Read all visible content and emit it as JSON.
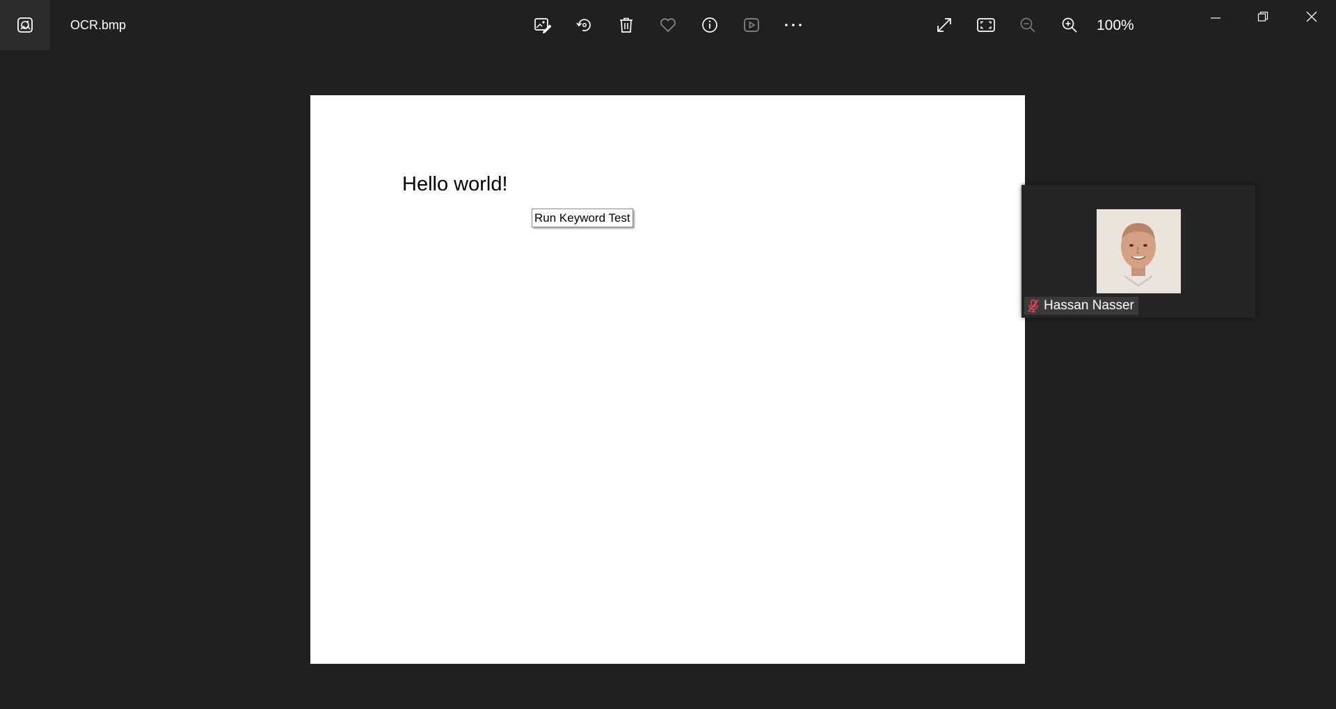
{
  "window": {
    "file_name": "OCR.bmp",
    "zoom_level": "100%"
  },
  "toolbar": {
    "icons": [
      "edit-image-icon",
      "rotate-icon",
      "delete-icon",
      "favorite-icon",
      "info-icon",
      "slideshow-icon",
      "more-icon"
    ],
    "right_icons": [
      "fullscreen-icon",
      "fit-to-window-icon",
      "zoom-out-icon",
      "zoom-in-icon"
    ]
  },
  "image": {
    "text": "Hello world!",
    "tooltip": "Run Keyword Test"
  },
  "participant": {
    "name": "Hassan Nasser",
    "mic_state": "muted",
    "mic_color": "#e74856"
  },
  "colors": {
    "background": "#202020",
    "titlebar_accent": "#2b2b2b"
  }
}
